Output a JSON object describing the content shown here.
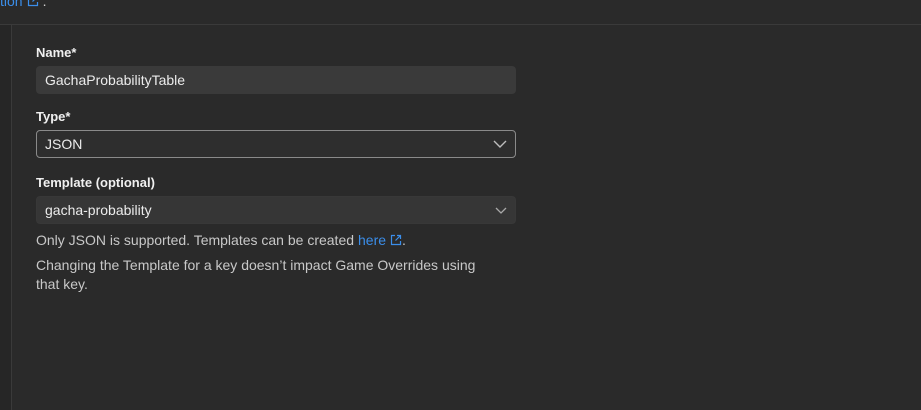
{
  "top": {
    "link_text": "tion",
    "trail": "."
  },
  "form": {
    "name": {
      "label": "Name*",
      "value": "GachaProbabilityTable"
    },
    "type": {
      "label": "Type*",
      "value": "JSON"
    },
    "template": {
      "label": "Template (optional)",
      "value": "gacha-probability"
    },
    "help": {
      "prefix": "Only JSON is supported. Templates can be created",
      "link": "here",
      "suffix": ".",
      "note": "Changing the Template for a key doesn’t impact Game Overrides using that key."
    }
  },
  "colors": {
    "background": "#2a2a2a",
    "link": "#3b8eea",
    "input_bg": "#3a3a3a"
  }
}
